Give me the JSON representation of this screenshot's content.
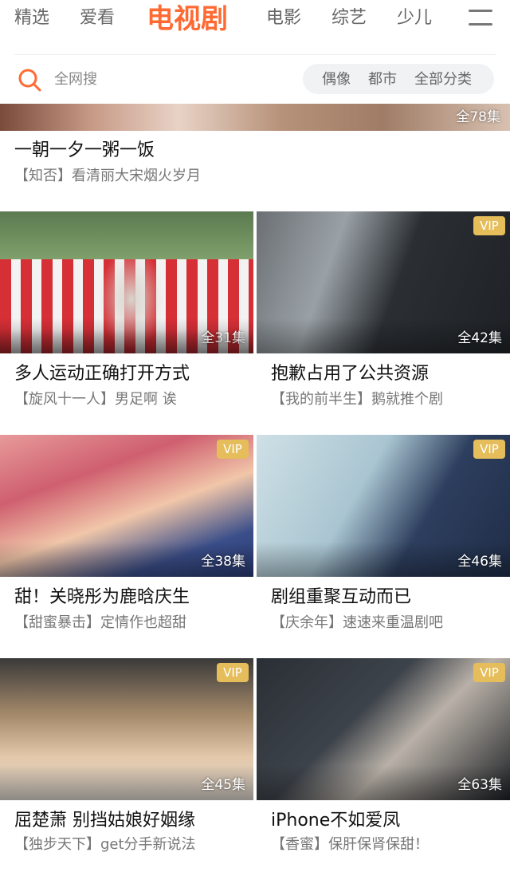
{
  "nav": {
    "tabs": [
      "精选",
      "爱看",
      "电视剧",
      "电影",
      "综艺",
      "少儿"
    ],
    "active_index": 2,
    "menu_icon": "hamburger-icon"
  },
  "search": {
    "icon": "search-icon",
    "placeholder": "全网搜",
    "categories": [
      "偶像",
      "都市",
      "全部分类"
    ]
  },
  "colors": {
    "accent": "#ff6a33",
    "vip_badge": "#e5bd5a"
  },
  "banner": {
    "episodes": "全78集",
    "title": "一朝一夕一粥一饭",
    "subtitle": "【知否】看清丽大宋烟火岁月"
  },
  "cards": [
    {
      "episodes": "全31集",
      "vip": false,
      "title": "多人运动正确打开方式",
      "subtitle": "【旋风十一人】男足啊 诶"
    },
    {
      "episodes": "全42集",
      "vip": true,
      "vip_label": "VIP",
      "title": "抱歉占用了公共资源",
      "subtitle": "【我的前半生】鹅就推个剧"
    },
    {
      "episodes": "全38集",
      "vip": true,
      "vip_label": "VIP",
      "title": "甜！关晓彤为鹿晗庆生",
      "subtitle": "【甜蜜暴击】定情作也超甜"
    },
    {
      "episodes": "全46集",
      "vip": true,
      "vip_label": "VIP",
      "title": "剧组重聚互动而已",
      "subtitle": "【庆余年】速速来重温剧吧"
    },
    {
      "episodes": "全45集",
      "vip": true,
      "vip_label": "VIP",
      "title": "屈楚萧 别挡姑娘好姻缘",
      "subtitle": "【独步天下】get分手新说法"
    },
    {
      "episodes": "全63集",
      "vip": true,
      "vip_label": "VIP",
      "title": "iPhone不如爱凤",
      "subtitle": "【香蜜】保肝保肾保甜！"
    }
  ]
}
